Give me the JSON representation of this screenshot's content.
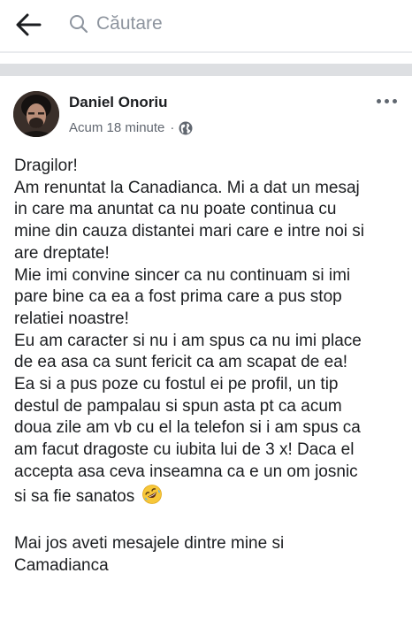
{
  "header": {
    "search_placeholder": "Căutare"
  },
  "post": {
    "author": "Daniel Onoriu",
    "time": "Acum 18 minute",
    "separator": "·",
    "privacy_icon": "globe-icon",
    "body_lines": [
      "Dragilor!",
      "Am renuntat la Canadianca. Mi a dat un mesaj",
      "in care ma anuntat ca nu poate continua cu",
      "mine din cauza distantei mari care e intre noi si",
      "are dreptate!",
      "Mie imi convine sincer ca nu continuam si imi",
      "pare bine ca ea a fost prima care a pus stop",
      "relatiei noastre!",
      "Eu am caracter si nu i am spus ca nu imi place",
      "de ea asa ca sunt fericit ca am scapat de ea!",
      "Ea si a pus poze cu fostul ei pe profil, un tip",
      "destul de pampalau si spun asta pt ca acum",
      "doua zile am vb cu el la telefon si i am spus ca",
      "am facut dragoste cu iubita lui de 3 x! Daca el",
      "accepta asa ceva inseamna ca e un om josnic",
      "si sa fie sanatos"
    ],
    "emoji": "rolling-on-floor-laughing",
    "closing_lines": [
      "Mai jos aveti mesajele dintre mine si",
      "Camadianca"
    ]
  },
  "colors": {
    "text": "#1c1e21",
    "secondary": "#616770",
    "placeholder": "#8d949e",
    "divider": "#dddfe2"
  }
}
